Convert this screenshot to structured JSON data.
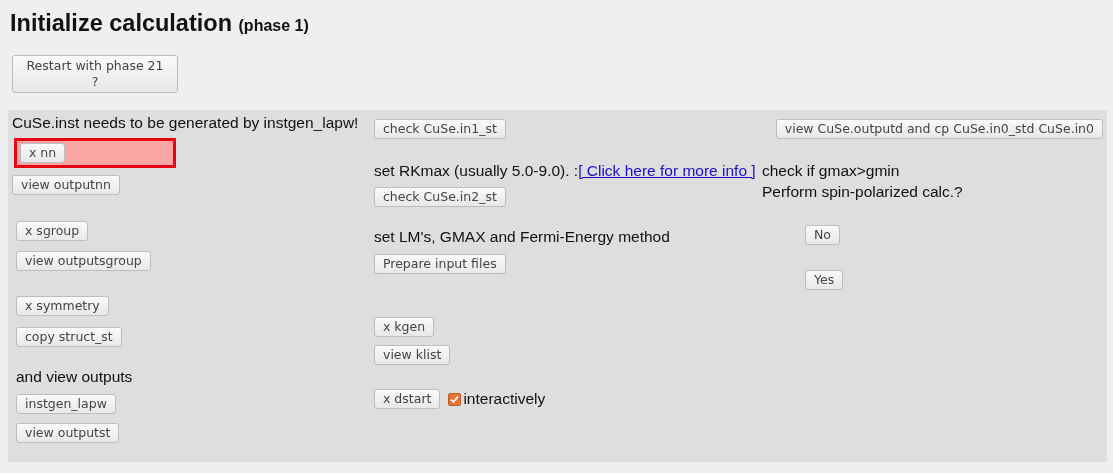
{
  "title": {
    "main": "Initialize calculation",
    "sub": "(phase 1)"
  },
  "restart_button": "Restart with phase 21\n?",
  "columns": [
    {
      "groups": [
        [
          {
            "kind": "label",
            "text": "CuSe.inst needs to be generated by instgen_lapw!"
          },
          {
            "kind": "highlighted_button",
            "text": "x nn"
          },
          {
            "kind": "button",
            "text": "view outputnn"
          }
        ],
        [
          {
            "kind": "button",
            "text": "x sgroup"
          },
          {
            "kind": "button",
            "text": "view outputsgroup"
          }
        ],
        [
          {
            "kind": "button",
            "text": "x symmetry"
          },
          {
            "kind": "button",
            "text": "copy struct_st"
          }
        ],
        [
          {
            "kind": "label",
            "text": "and view outputs"
          },
          {
            "kind": "button",
            "text": "instgen_lapw"
          },
          {
            "kind": "button",
            "text": "view outputst"
          }
        ]
      ]
    },
    {
      "groups": [
        [
          {
            "kind": "button",
            "text": "check CuSe.in1_st"
          }
        ],
        [
          {
            "kind": "label_link",
            "text": "set RKmax (usually 5.0-9.0). :",
            "link": "[ Click here for more info ]"
          },
          {
            "kind": "button",
            "text": "check CuSe.in2_st"
          }
        ],
        [
          {
            "kind": "label",
            "text": "set LM's, GMAX and Fermi-Energy method"
          },
          {
            "kind": "button",
            "text": "Prepare input files"
          }
        ],
        [
          {
            "kind": "button",
            "text": "x kgen"
          },
          {
            "kind": "button",
            "text": "view klist"
          }
        ],
        [
          {
            "kind": "button_checkbox",
            "text": "x dstart",
            "checkbox": {
              "label": "interactively",
              "checked": true
            }
          }
        ]
      ]
    },
    {
      "groups": [
        [
          {
            "kind": "right_button",
            "text": "view CuSe.outputd and cp CuSe.in0_std CuSe.in0"
          }
        ],
        [
          {
            "kind": "label",
            "text": "check if gmax>gmin"
          },
          {
            "kind": "label",
            "text": "Perform spin-polarized calc.?"
          }
        ],
        [
          {
            "kind": "button",
            "text": "No"
          }
        ],
        [
          {
            "kind": "button",
            "text": "Yes"
          }
        ]
      ]
    }
  ]
}
